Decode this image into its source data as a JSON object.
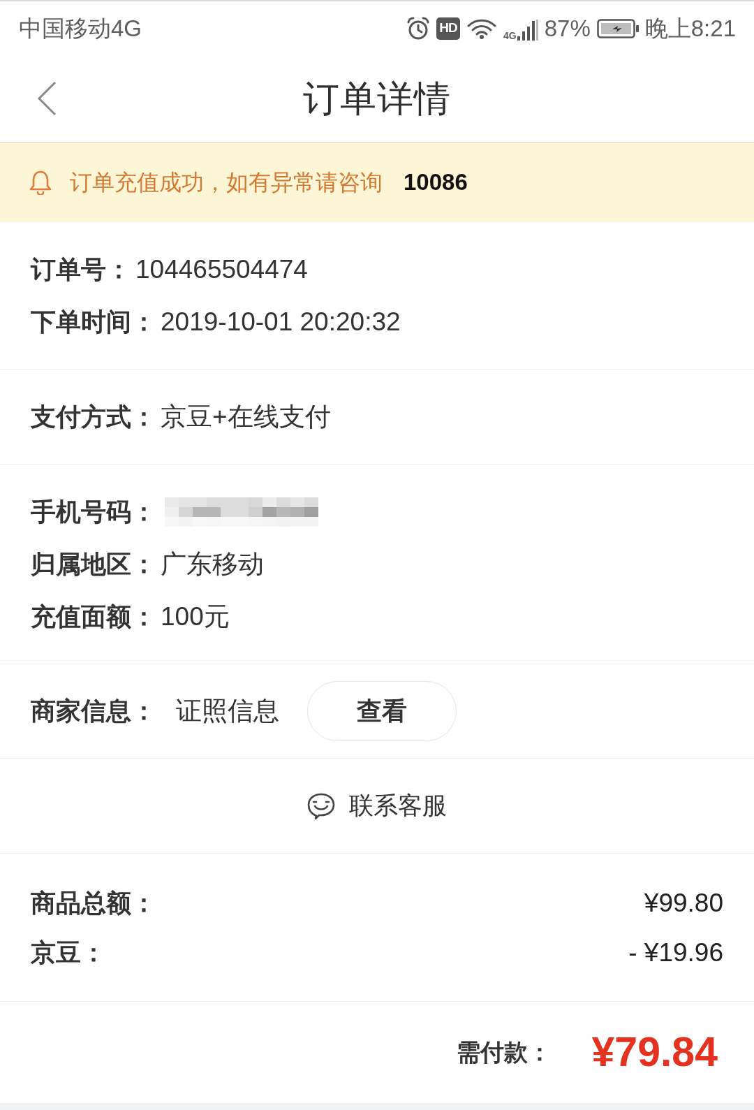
{
  "status_bar": {
    "carrier": "中国移动4G",
    "hd": "HD",
    "network": "4G",
    "battery": "87%",
    "time": "晚上8:21"
  },
  "header": {
    "title": "订单详情"
  },
  "notice": {
    "text": "订单充值成功，如有异常请咨询",
    "phone": "10086"
  },
  "sections": [
    {
      "rows": [
        {
          "kind": "text",
          "label": "订单号：",
          "value": "104465504474"
        },
        {
          "kind": "text",
          "label": "下单时间：",
          "value": "2019-10-01 20:20:32"
        }
      ]
    },
    {
      "rows": [
        {
          "kind": "text",
          "label": "支付方式：",
          "value": "京豆+在线支付"
        }
      ]
    },
    {
      "rows": [
        {
          "kind": "redacted",
          "label": "手机号码："
        },
        {
          "kind": "text",
          "label": "归属地区：",
          "value": "广东移动"
        },
        {
          "kind": "text",
          "label": "充值面额：",
          "value": "100元"
        }
      ]
    },
    {
      "rows": [
        {
          "kind": "button",
          "label": "商家信息：",
          "value": "证照信息",
          "button": "查看"
        }
      ]
    }
  ],
  "contact": {
    "label": "联系客服"
  },
  "amounts": [
    {
      "label": "商品总额：",
      "value": "¥99.80"
    },
    {
      "label": "京豆：",
      "value": "- ¥19.96"
    }
  ],
  "total": {
    "label": "需付款：",
    "value": "¥79.84"
  }
}
